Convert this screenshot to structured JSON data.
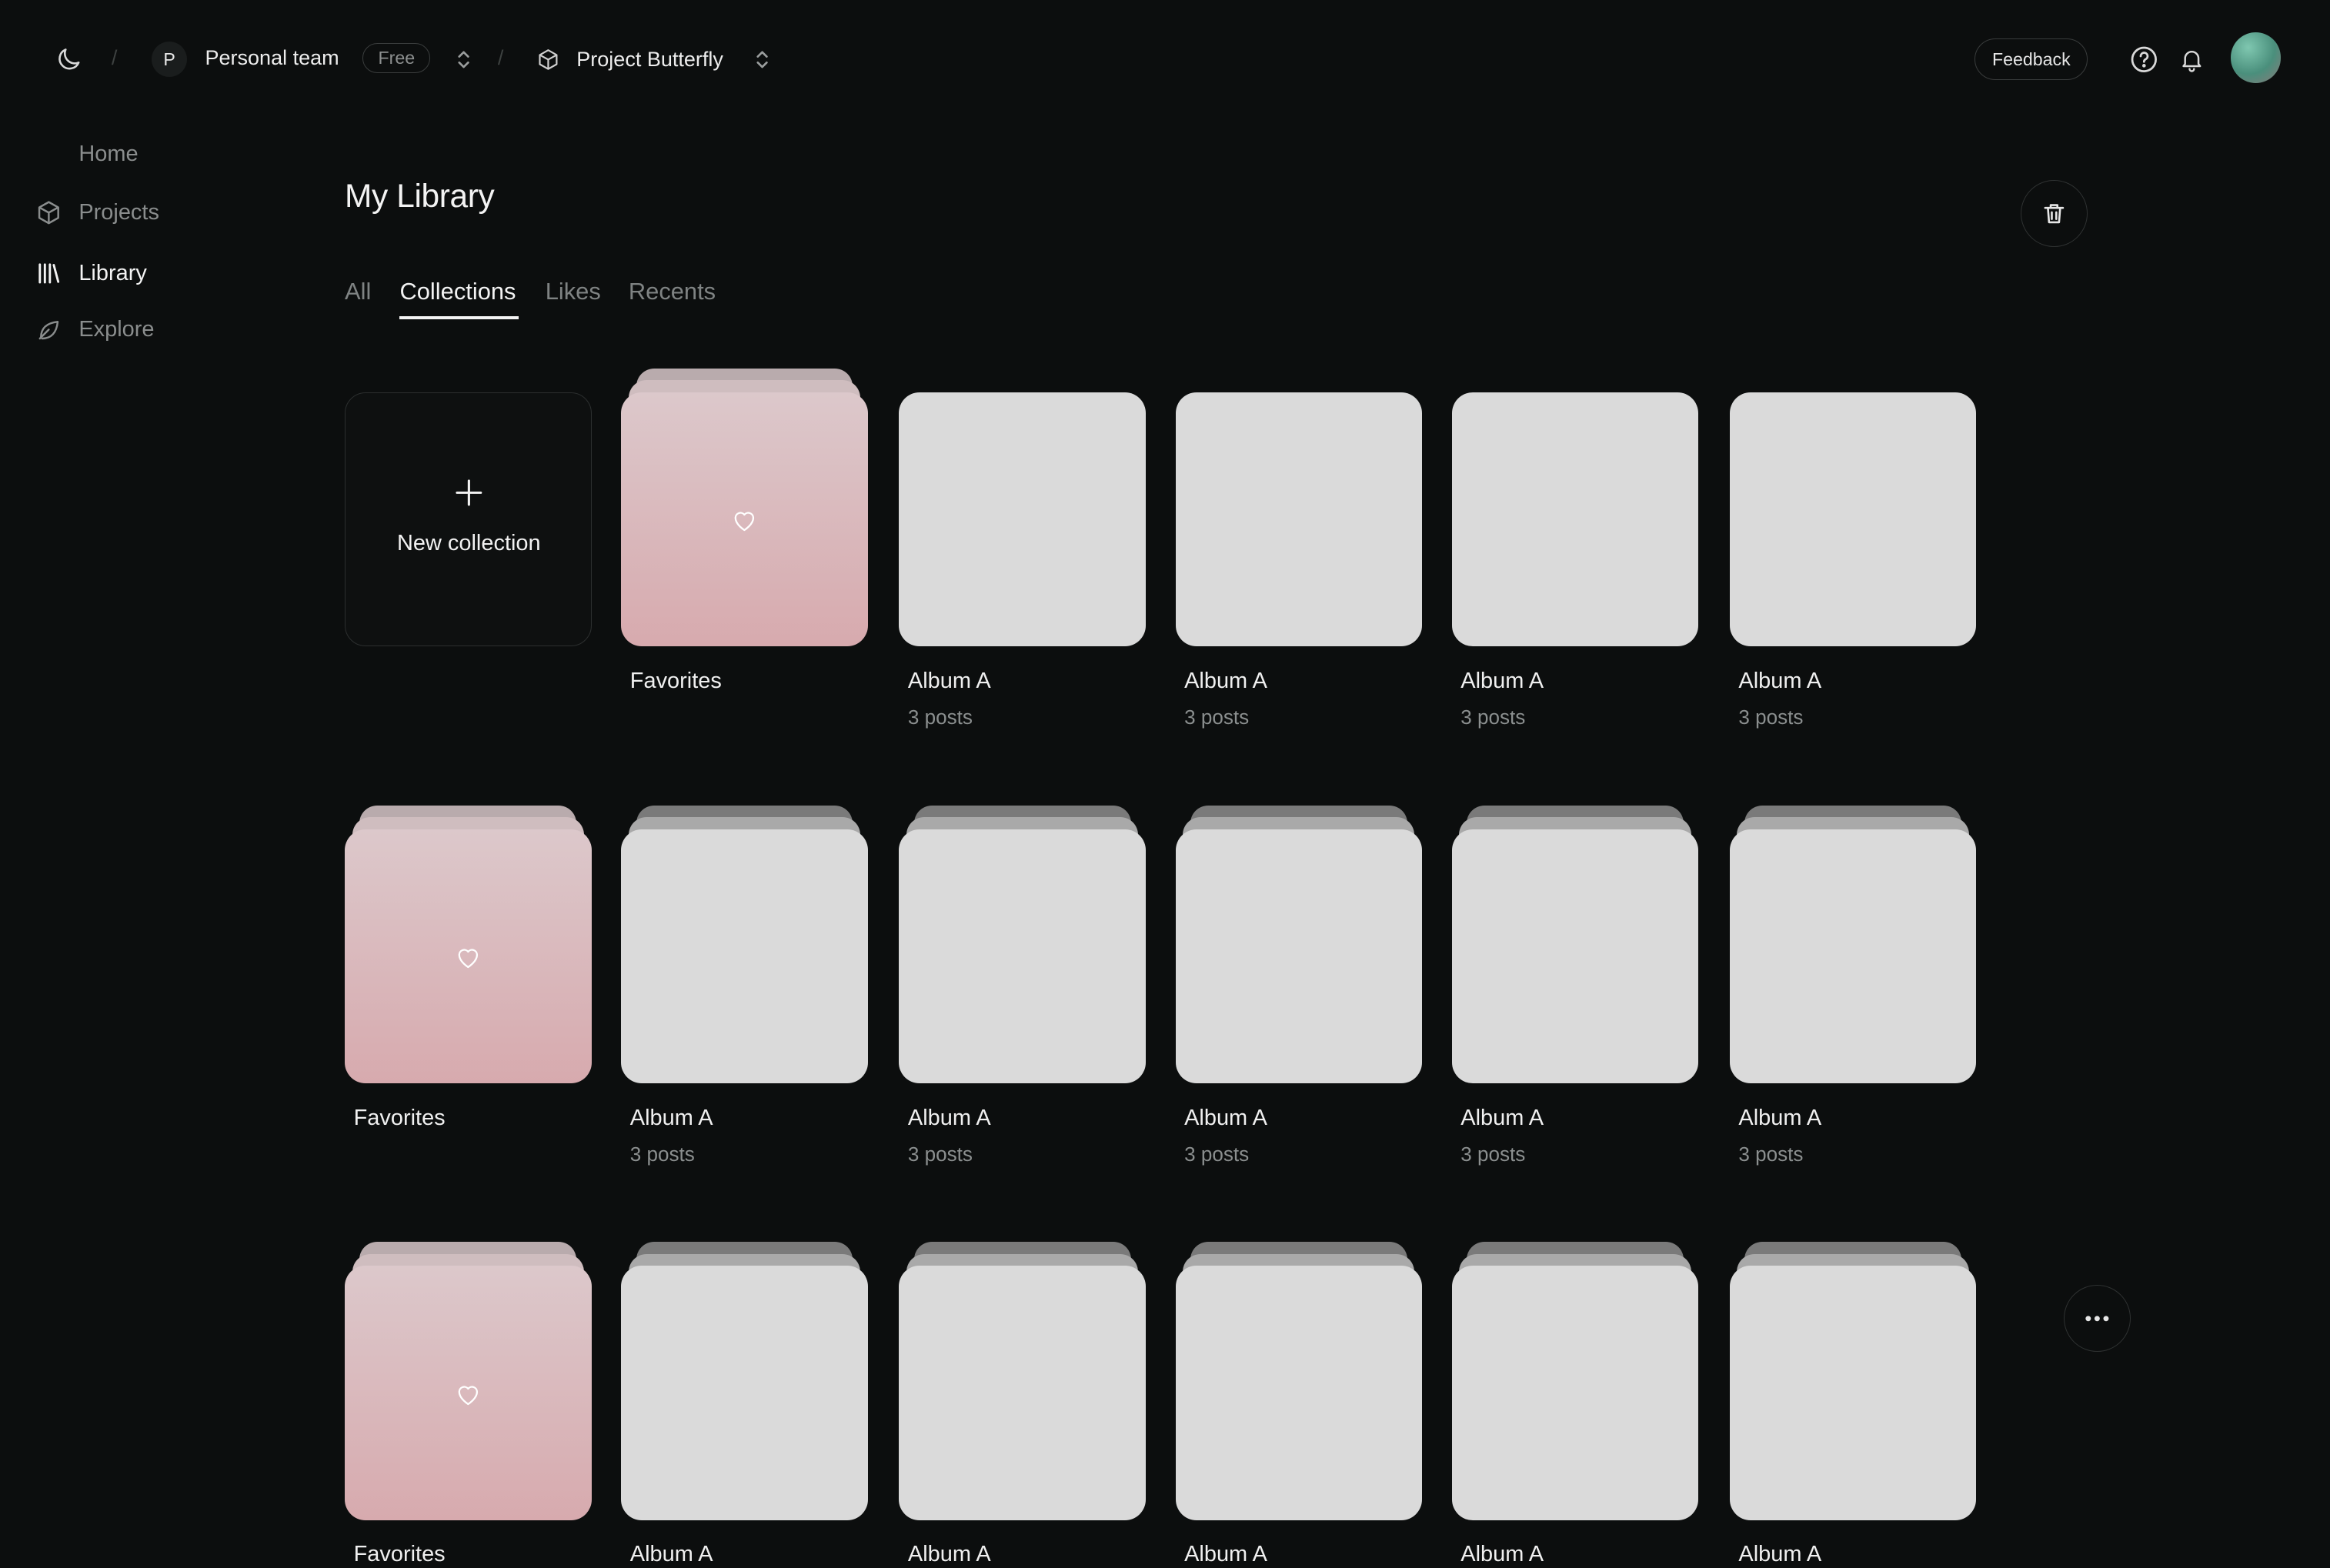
{
  "topbar": {
    "separator": "/",
    "team_initial": "P",
    "team_name": "Personal team",
    "plan": "Free",
    "project_name": "Project Butterfly",
    "feedback_label": "Feedback"
  },
  "sidebar": {
    "items": [
      {
        "label": "Home",
        "icon": "home",
        "active": false
      },
      {
        "label": "Projects",
        "icon": "cube-icon",
        "active": false
      },
      {
        "label": "Library",
        "icon": "library-icon",
        "active": true
      },
      {
        "label": "Explore",
        "icon": "leaf-icon",
        "active": false
      }
    ]
  },
  "main": {
    "title": "My Library",
    "tabs": [
      {
        "label": "All",
        "active": false
      },
      {
        "label": "Collections",
        "active": true
      },
      {
        "label": "Likes",
        "active": false
      },
      {
        "label": "Recents",
        "active": false
      }
    ],
    "new_collection_label": "New collection",
    "collections": [
      [
        {
          "type": "favorites",
          "name": "Favorites",
          "count": ""
        },
        {
          "type": "album",
          "name": "Album A",
          "count": "3 posts"
        },
        {
          "type": "album",
          "name": "Album A",
          "count": "3 posts"
        },
        {
          "type": "album",
          "name": "Album A",
          "count": "3 posts"
        },
        {
          "type": "album",
          "name": "Album A",
          "count": "3 posts"
        }
      ],
      [
        {
          "type": "favorites",
          "name": "Favorites",
          "count": ""
        },
        {
          "type": "album",
          "name": "Album A",
          "count": "3 posts"
        },
        {
          "type": "album",
          "name": "Album A",
          "count": "3 posts"
        },
        {
          "type": "album",
          "name": "Album A",
          "count": "3 posts"
        },
        {
          "type": "album",
          "name": "Album A",
          "count": "3 posts"
        },
        {
          "type": "album",
          "name": "Album A",
          "count": "3 posts"
        }
      ],
      [
        {
          "type": "favorites",
          "name": "Favorites",
          "count": ""
        },
        {
          "type": "album",
          "name": "Album A",
          "count": ""
        },
        {
          "type": "album",
          "name": "Album A",
          "count": ""
        },
        {
          "type": "album",
          "name": "Album A",
          "count": ""
        },
        {
          "type": "album",
          "name": "Album A",
          "count": ""
        },
        {
          "type": "album",
          "name": "Album A",
          "count": ""
        }
      ]
    ]
  },
  "colors": {
    "background": "#0c0e0e",
    "tile_gray": "#dadada",
    "tile_pink_top": "#dcc8cb",
    "tile_pink_bottom": "#d7aaae",
    "muted_text": "#8b8f8f"
  }
}
